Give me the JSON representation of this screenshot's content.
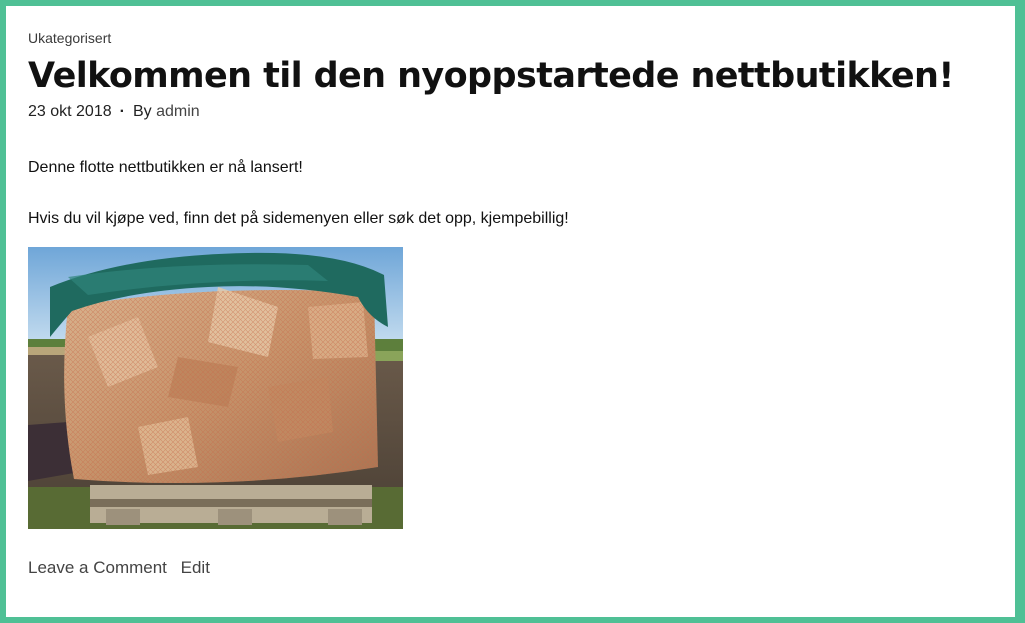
{
  "post": {
    "category": "Ukategorisert",
    "title": "Velkommen til den nyoppstartede nettbutikken!",
    "date": "23 okt 2018",
    "separator": "·",
    "by_label": "By",
    "author": "admin",
    "paragraphs": [
      "Denne flotte nettbutikken er nå lansert!",
      "Hvis du vil kjøpe ved, finn det på sidemenyen eller søk det opp, kjempebillig!"
    ],
    "comment_link": "Leave a Comment",
    "edit_link": "Edit"
  },
  "colors": {
    "frame_border": "#4fc095",
    "background": "#ffffff",
    "text": "#111111"
  }
}
